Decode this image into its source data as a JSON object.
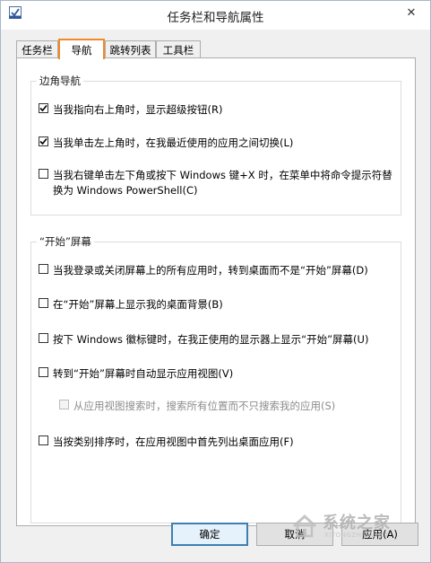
{
  "window": {
    "title": "任务栏和导航属性",
    "close_glyph": "✕"
  },
  "tabs": [
    {
      "label": "任务栏",
      "active": false
    },
    {
      "label": "导航",
      "active": true
    },
    {
      "label": "跳转列表",
      "active": false
    },
    {
      "label": "工具栏",
      "active": false
    }
  ],
  "corner_nav": {
    "title": "边角导航",
    "options": [
      {
        "label": "当我指向右上角时，显示超级按钮(R)",
        "checked": true
      },
      {
        "label": "当我单击左上角时，在我最近使用的应用之间切换(L)",
        "checked": true
      },
      {
        "label": "当我右键单击左下角或按下 Windows 键+X 时，在菜单中将命令提示符替换为 Windows PowerShell(C)",
        "checked": false
      }
    ]
  },
  "start_screen": {
    "title": "“开始”屏幕",
    "options": [
      {
        "label": "当我登录或关闭屏幕上的所有应用时，转到桌面而不是“开始”屏幕(D)",
        "checked": false
      },
      {
        "label": "在“开始”屏幕上显示我的桌面背景(B)",
        "checked": false
      },
      {
        "label": "按下 Windows 徽标键时，在我正使用的显示器上显示“开始”屏幕(U)",
        "checked": false
      },
      {
        "label": "转到“开始”屏幕时自动显示应用视图(V)",
        "checked": false
      },
      {
        "label": "从应用视图搜索时，搜索所有位置而不只搜索我的应用(S)",
        "checked": false,
        "disabled": true
      },
      {
        "label": "当按类别排序时，在应用视图中首先列出桌面应用(F)",
        "checked": false
      }
    ]
  },
  "buttons": {
    "ok": "确定",
    "cancel": "取消",
    "apply": "应用(A)"
  },
  "watermark": {
    "text": "系统之家",
    "sub": "XITONGZHIJIA.NET"
  },
  "colors": {
    "tab_highlight": "#f08a24",
    "ok_border": "#3c7fb1"
  }
}
